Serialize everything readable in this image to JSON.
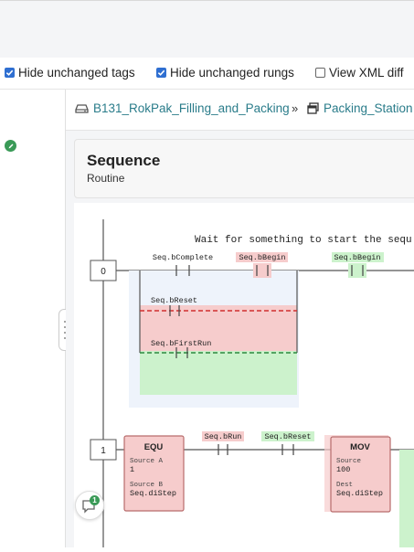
{
  "options": {
    "hide_tags": {
      "label": "Hide unchanged tags",
      "checked": true
    },
    "hide_rungs": {
      "label": "Hide unchanged rungs",
      "checked": true
    },
    "view_xml": {
      "label": "View XML diff",
      "checked": false
    }
  },
  "breadcrumb": {
    "program": "B131_RokPak_Filling_and_Packing",
    "separator": "»",
    "routine": "Packing_Station"
  },
  "routine": {
    "title": "Sequence",
    "type": "Routine"
  },
  "rungs": [
    {
      "number": "0",
      "comment": "Wait for something to start the sequ",
      "tags": {
        "complete": "Seq.bComplete",
        "begin_old": "Seq.bBegin",
        "begin_new": "Seq.bBegin",
        "reset": "Seq.bReset",
        "first_run": "Seq.bFirstRun"
      }
    },
    {
      "number": "1",
      "equ": {
        "name": "EQU",
        "src_a_label": "Source A",
        "src_a": "1",
        "src_b_label": "Source B",
        "src_b": "Seq.diStep"
      },
      "tags": {
        "run": "Seq.bRun",
        "reset": "Seq.bReset"
      },
      "mov": {
        "name": "MOV",
        "src_label": "Source",
        "src": "100",
        "dest_label": "Dest",
        "dest": "Seq.diStep"
      }
    }
  ],
  "comments_badge": "1",
  "colors": {
    "accent": "#2f6fd1",
    "link": "#2a7c8a",
    "removed": "#f6cccc",
    "added": "#ccf2cc",
    "removed_line": "#d12e2e",
    "added_line": "#2d8a3e"
  }
}
